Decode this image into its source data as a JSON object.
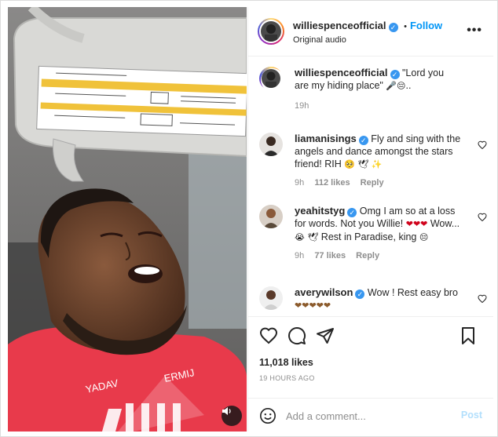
{
  "post": {
    "author": "williespenceofficial",
    "follow_label": "Follow",
    "separator": "•",
    "audio_label": "Original audio",
    "caption": "\"Lord you are my hiding place\"",
    "caption_tail": "..",
    "caption_time": "19h",
    "likes": "11,018 likes",
    "timestamp": "19 HOURS AGO",
    "video_text_line1": "YADAV",
    "video_text_line2": "ERMIJ"
  },
  "comments": [
    {
      "user": "liamanisings",
      "text": "Fly and sing with the angels and dance amongst the stars friend! RIH",
      "time": "9h",
      "likes": "112 likes",
      "reply": "Reply"
    },
    {
      "user": "yeahitstyg",
      "text": "Omg I am so at a loss for words. Not you Willie!",
      "text2": "Wow...",
      "text3": "Rest in Paradise, king",
      "time": "9h",
      "likes": "77 likes",
      "reply": "Reply"
    },
    {
      "user": "averywilson",
      "text": "Wow ! Rest easy bro"
    }
  ],
  "add_comment": {
    "placeholder": "Add a comment...",
    "post_label": "Post"
  },
  "icons": {
    "more": "more-options-icon",
    "verified": "verified-badge-icon",
    "heart": "heart-icon",
    "comment": "comment-icon",
    "share": "share-icon",
    "save": "bookmark-icon",
    "emoji": "emoji-icon",
    "mute": "speaker-icon"
  },
  "colors": {
    "accent": "#0095f6",
    "text": "#262626",
    "muted": "#8e8e8e",
    "border": "#dbdbdb"
  }
}
